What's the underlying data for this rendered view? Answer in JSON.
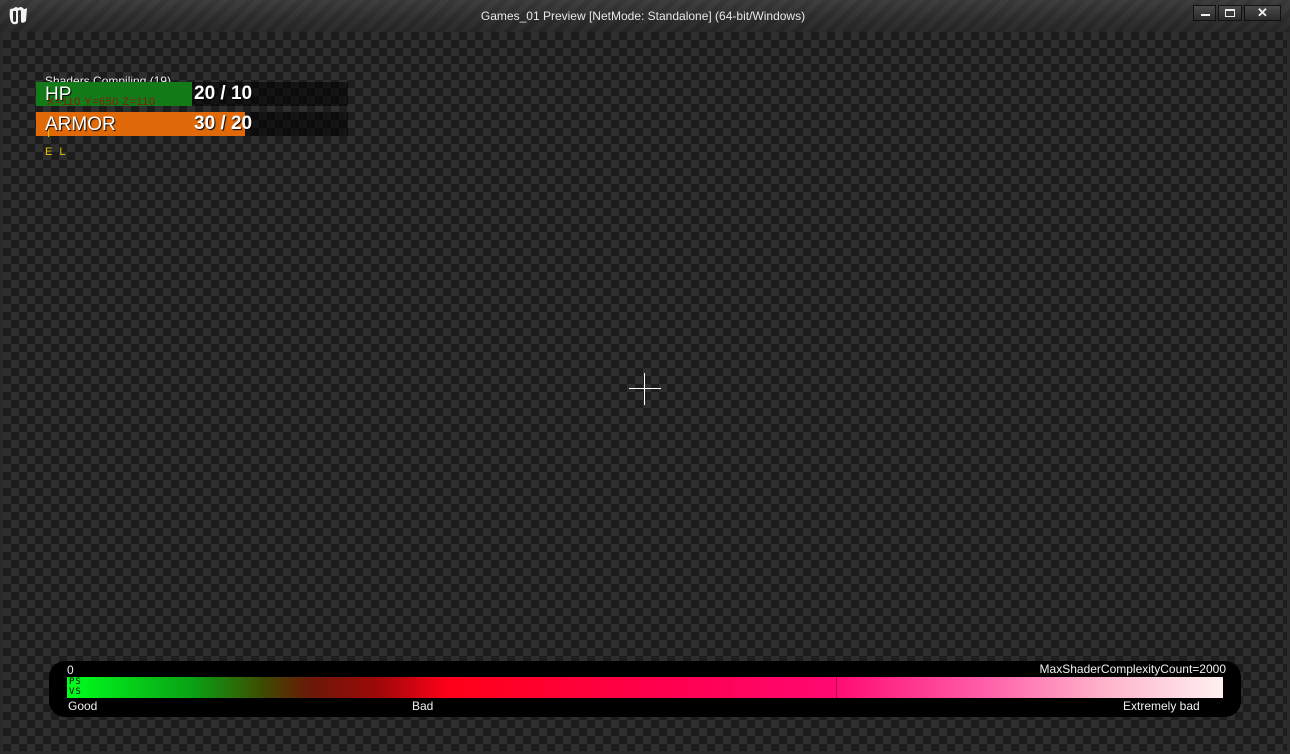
{
  "window": {
    "title": "Games_01 Preview [NetMode: Standalone] (64-bit/Windows)",
    "controls": {
      "minimize": "minimize",
      "maximize": "maximize",
      "close": "✕"
    }
  },
  "hud": {
    "shaders_message": "Shaders Compiling (19)",
    "hp": {
      "label": "HP",
      "value_text": "20 / 10",
      "fill_fraction": 0.5,
      "color": "#127a18"
    },
    "armor": {
      "label": "ARMOR",
      "value_text": "30 / 20",
      "fill_fraction": 0.67,
      "color": "#e06a0a"
    },
    "debug_text": "X=110 Y=650 Z=110",
    "yellow_line_1": "I",
    "yellow_line_2": "E L"
  },
  "complexity": {
    "min_label": "0",
    "max_label": "MaxShaderComplexityCount=2000",
    "ps_label": "PS",
    "vs_label": "VS",
    "good_label": "Good",
    "bad_label": "Bad",
    "extremely_bad_label": "Extremely bad"
  }
}
